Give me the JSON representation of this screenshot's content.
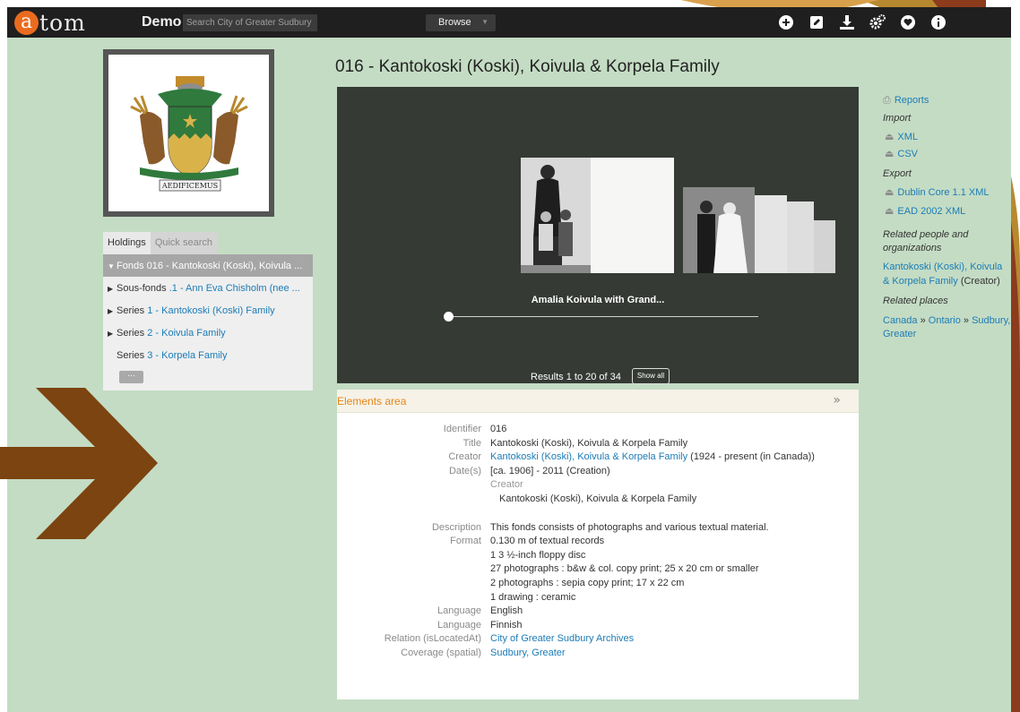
{
  "colors": {
    "header_bg": "#1f1f1f",
    "page_bg": "#c4dcc4",
    "link": "#1c7cb6",
    "accent_orange": "#e58618",
    "logo_orange": "#ea6b1f",
    "arrow_brown": "#7b4410"
  },
  "header": {
    "logo_letter": "a",
    "logo_rest": "tom",
    "site_title": "Demo",
    "search_placeholder": "Search City of Greater Sudbury Archives",
    "browse_label": "Browse",
    "icons": [
      "plus-circle-icon",
      "edit-icon",
      "download-icon",
      "gears-icon",
      "heart-icon",
      "info-icon"
    ]
  },
  "sidebar": {
    "tabs": [
      {
        "label": "Holdings",
        "active": true
      },
      {
        "label": "Quick search",
        "active": false
      }
    ],
    "tree": [
      {
        "triangle": "▼",
        "type": "Fonds",
        "label": "016 - Kantokoski (Koski), Koivula ..."
      },
      {
        "triangle": "▶",
        "type": "Sous-fonds",
        "label": ".1 - Ann Eva Chisholm (nee ..."
      },
      {
        "triangle": "▶",
        "type": "Series",
        "label": "1 - Kantokoski (Koski) Family"
      },
      {
        "triangle": "▶",
        "type": "Series",
        "label": "2 - Koivula Family"
      },
      {
        "triangle": "",
        "type": "Series",
        "label": "3 - Korpela Family"
      }
    ],
    "more_label": "..."
  },
  "main": {
    "title": "016 - Kantokoski (Koski), Koivula & Korpela Family",
    "viewer": {
      "caption": "Amalia Koivula with Grand...",
      "results_text": "Results 1 to 20 of 34",
      "show_all_label": "Show all"
    },
    "elements": {
      "title": "Elements area",
      "toggle": "»",
      "identifier": {
        "label": "Identifier",
        "value": "016"
      },
      "title_field": {
        "label": "Title",
        "value": "Kantokoski (Koski), Koivula & Korpela Family"
      },
      "creator": {
        "label": "Creator",
        "link": "Kantokoski (Koski), Koivula & Korpela Family",
        "extra": " (1924 - present (in Canada))"
      },
      "dates": {
        "label": "Date(s)",
        "value": "[ca. 1906] - 2011 (Creation)",
        "sub_label": "Creator",
        "sub_value": "Kantokoski (Koski), Koivula & Korpela Family"
      },
      "description": {
        "label": "Description",
        "value": "This fonds consists of photographs and various textual material."
      },
      "format": {
        "label": "Format",
        "lines": [
          "0.130 m of textual records",
          "1 3 ½-inch floppy disc",
          "27 photographs : b&w & col. copy print; 25 x 20 cm or smaller",
          "2 photographs : sepia copy print; 17 x 22 cm",
          "1 drawing : ceramic"
        ]
      },
      "language1": {
        "label": "Language",
        "value": "English"
      },
      "language2": {
        "label": "Language",
        "value": "Finnish"
      },
      "relation": {
        "label": "Relation (isLocatedAt)",
        "value": "City of Greater Sudbury Archives"
      },
      "coverage": {
        "label": "Coverage (spatial)",
        "value": "Sudbury, Greater"
      }
    }
  },
  "right_sidebar": {
    "reports": "Reports",
    "import_heading": "Import",
    "import_items": [
      "XML",
      "CSV"
    ],
    "export_heading": "Export",
    "export_items": [
      "Dublin Core 1.1 XML",
      "EAD 2002 XML"
    ],
    "related_people_heading": "Related people and organizations",
    "related_person_link": "Kantokoski (Koski), Koivula & Korpela Family",
    "related_person_role": " (Creator)",
    "related_places_heading": "Related places",
    "places": [
      "Canada",
      "Ontario",
      "Sudbury, Greater"
    ],
    "place_separator": " » "
  },
  "logo_image": {
    "motto": "AEDIFICEMUS"
  }
}
